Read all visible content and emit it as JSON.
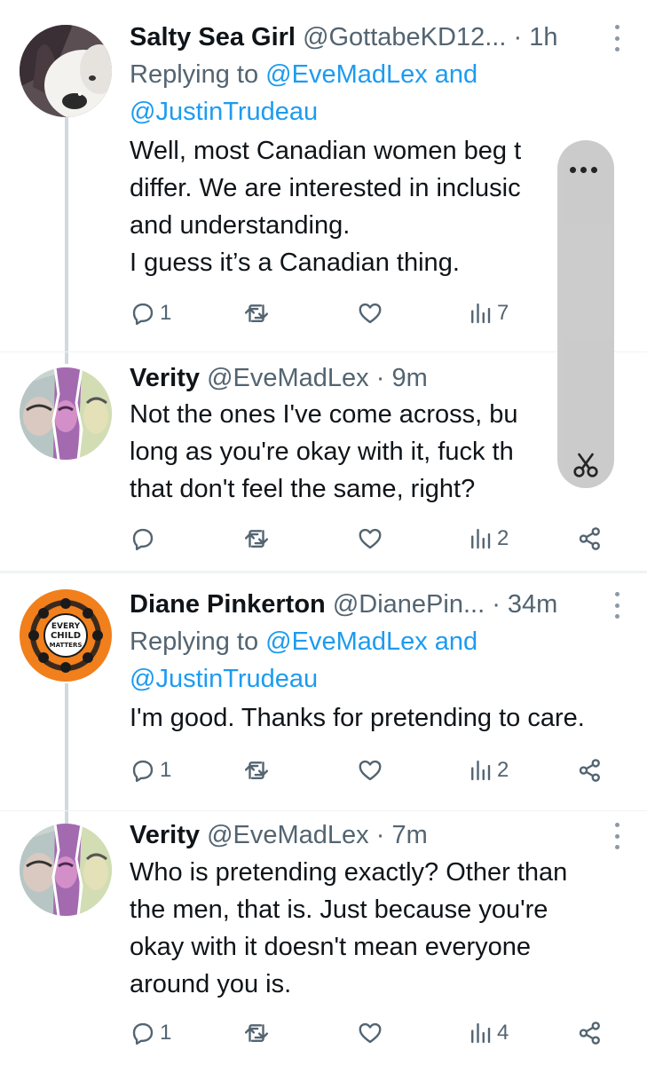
{
  "tweets": [
    {
      "name": "Salty Sea Girl",
      "handle": "@GottabeKD12...",
      "dot": " · ",
      "time": "1h",
      "replying_prefix": "Replying to ",
      "replying_to_1": "@EveMadLex and",
      "replying_to_2": "@JustinTrudeau",
      "text": "Well, most Canadian women beg t\ndiffer. We are interested in inclusic\nand understanding.\nI guess it’s a Canadian thing.",
      "replies": "1",
      "views": "7",
      "avatar_icon": "dog-photo-avatar"
    },
    {
      "name": "Verity",
      "handle": "@EveMadLex",
      "dot": " · ",
      "time": "9m",
      "text": "Not the ones I've come across, bu\nlong as you're okay with it, fuck th\nthat don't feel the same, right?",
      "replies": "",
      "views": "2",
      "avatar_icon": "selfie-collage-avatar"
    },
    {
      "name": "Diane Pinkerton",
      "handle": "@DianePin...",
      "dot": " · ",
      "time": "34m",
      "replying_prefix": "Replying to ",
      "replying_to_1": "@EveMadLex and",
      "replying_to_2": "@JustinTrudeau",
      "text": "I'm good. Thanks for pretending to care.",
      "replies": "1",
      "views": "2",
      "avatar_icon": "every-child-matters-avatar",
      "avatar_text": [
        "EVERY",
        "CHILD",
        "MATTERS"
      ]
    },
    {
      "name": "Verity",
      "handle": "@EveMadLex",
      "dot": " · ",
      "time": "7m",
      "text": "Who is pretending exactly? Other than\nthe men, that is. Just because you're\nokay with it doesn't mean everyone\naround you is.",
      "replies": "1",
      "views": "4",
      "avatar_icon": "selfie-collage-avatar"
    }
  ],
  "icons": {
    "reply": "reply-icon",
    "retweet": "retweet-icon",
    "like": "heart-icon",
    "views": "views-icon",
    "share": "share-icon",
    "more": "more-icon",
    "overlay_more": "overlay-more-icon",
    "overlay_tool": "scissors-icon"
  },
  "colors": {
    "link": "#1d9bf0",
    "text": "#0f1419",
    "muted": "#536471",
    "thread_line": "#cfd9de",
    "orange": "#f07f1c"
  }
}
